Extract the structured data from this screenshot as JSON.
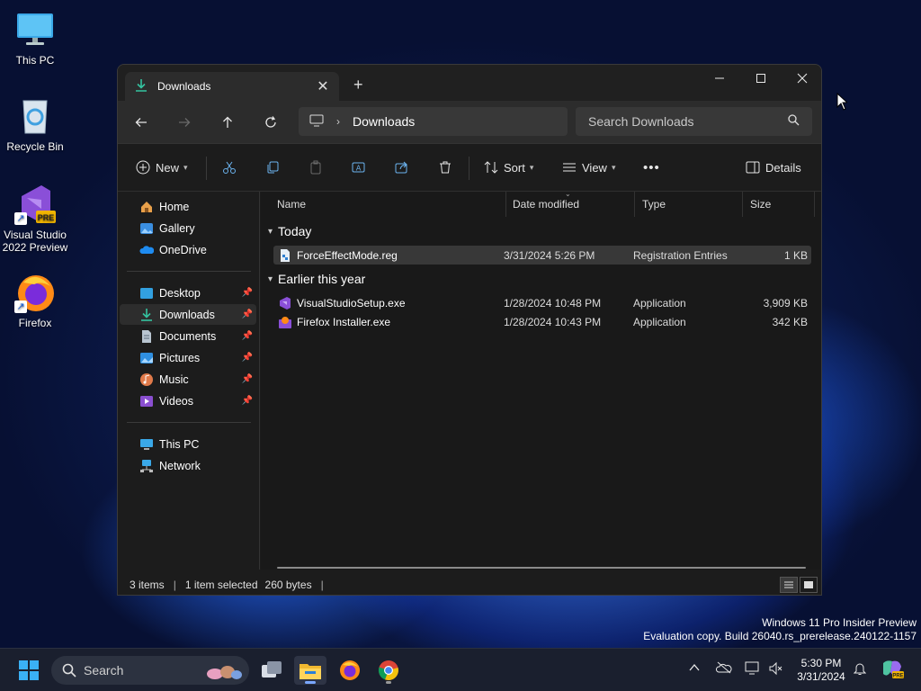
{
  "desktop": {
    "icons": [
      {
        "label": "This PC"
      },
      {
        "label": "Recycle Bin"
      },
      {
        "label": "Visual Studio 2022 Preview",
        "badge": "PRE"
      },
      {
        "label": "Firefox"
      }
    ]
  },
  "window": {
    "tab_title": "Downloads",
    "new_tab": "+",
    "address": {
      "crumb": "Downloads"
    },
    "search": {
      "placeholder": "Search Downloads"
    },
    "toolbar": {
      "new_label": "New",
      "sort_label": "Sort",
      "view_label": "View",
      "more_label": "•••",
      "details_label": "Details"
    },
    "sidebar": {
      "items": [
        {
          "label": "Home",
          "icon": "home-icon"
        },
        {
          "label": "Gallery",
          "icon": "gallery-icon"
        },
        {
          "label": "OneDrive",
          "icon": "onedrive-icon"
        },
        {
          "label": "Desktop",
          "icon": "desktop-icon",
          "pinned": true
        },
        {
          "label": "Downloads",
          "icon": "downloads-icon",
          "pinned": true,
          "selected": true
        },
        {
          "label": "Documents",
          "icon": "documents-icon",
          "pinned": true
        },
        {
          "label": "Pictures",
          "icon": "pictures-icon",
          "pinned": true
        },
        {
          "label": "Music",
          "icon": "music-icon",
          "pinned": true
        },
        {
          "label": "Videos",
          "icon": "videos-icon",
          "pinned": true
        },
        {
          "label": "This PC",
          "icon": "this-pc-icon"
        },
        {
          "label": "Network",
          "icon": "network-icon"
        }
      ]
    },
    "columns": [
      "Name",
      "Date modified",
      "Type",
      "Size"
    ],
    "groups": [
      {
        "title": "Today",
        "files": [
          {
            "name": "ForceEffectMode.reg",
            "date": "3/31/2024 5:26 PM",
            "type": "Registration Entries",
            "size": "1 KB",
            "selected": true
          }
        ]
      },
      {
        "title": "Earlier this year",
        "files": [
          {
            "name": "VisualStudioSetup.exe",
            "date": "1/28/2024 10:48 PM",
            "type": "Application",
            "size": "3,909 KB"
          },
          {
            "name": "Firefox Installer.exe",
            "date": "1/28/2024 10:43 PM",
            "type": "Application",
            "size": "342 KB"
          }
        ]
      }
    ],
    "status": {
      "items": "3 items",
      "selection": "1 item selected",
      "bytes": "260 bytes"
    }
  },
  "watermark": {
    "line1": "Windows 11 Pro Insider Preview",
    "line2": "Evaluation copy. Build 26040.rs_prerelease.240122-1157"
  },
  "taskbar": {
    "search_placeholder": "Search",
    "clock_time": "5:30 PM",
    "clock_date": "3/31/2024"
  },
  "colors": {
    "accent": "#4c8ef7",
    "window_bg": "#1c1c1c",
    "selected_row": "#383838"
  }
}
